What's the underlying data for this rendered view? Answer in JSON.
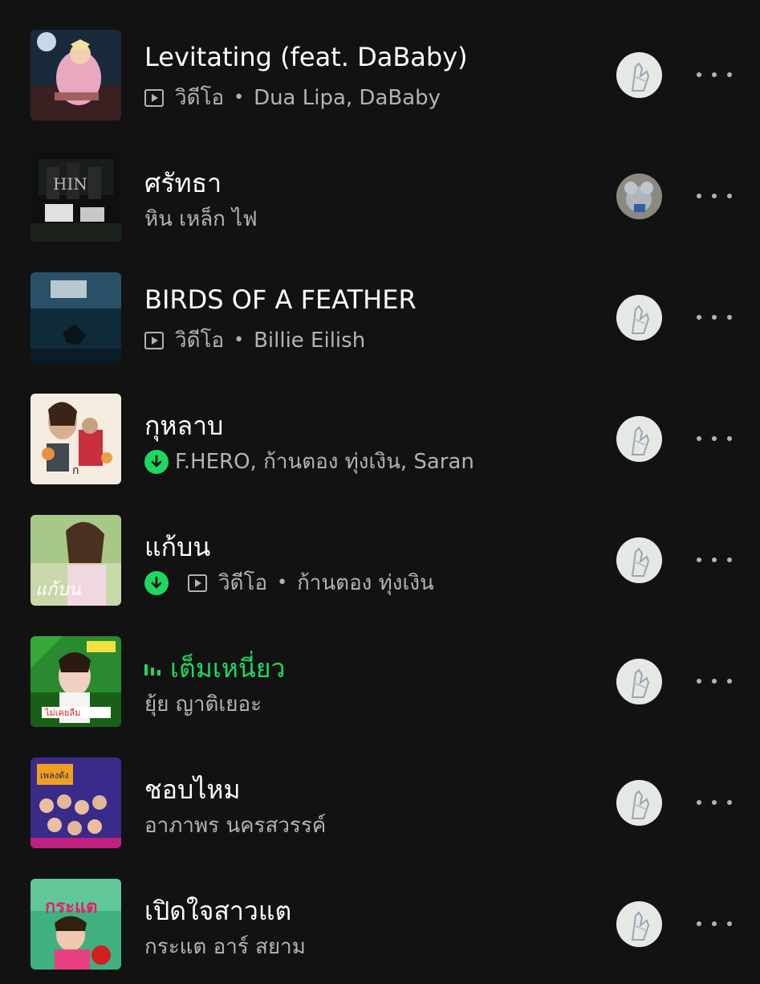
{
  "accent_color": "#1ed760",
  "tracks": [
    {
      "title": "Levitating (feat. DaBaby)",
      "video_label": "วิดีโอ",
      "artists": "Dua Lipa, DaBaby",
      "downloaded": false,
      "video": true,
      "playing": false,
      "added_by_avatar": "hands-avatar"
    },
    {
      "title": "ศรัทธา",
      "video_label": "",
      "artists": "หิน เหล็ก ไฟ",
      "downloaded": false,
      "video": false,
      "playing": false,
      "added_by_avatar": "mouse-avatar"
    },
    {
      "title": "BIRDS OF A FEATHER",
      "video_label": "วิดีโอ",
      "artists": "Billie Eilish",
      "downloaded": false,
      "video": true,
      "playing": false,
      "added_by_avatar": "hands-avatar"
    },
    {
      "title": "กุหลาบ",
      "video_label": "",
      "artists": "F.HERO, ก้านตอง ทุ่งเงิน, Saran",
      "downloaded": true,
      "video": false,
      "playing": false,
      "added_by_avatar": "hands-avatar"
    },
    {
      "title": "แก้บน",
      "video_label": "วิดีโอ",
      "artists": "ก้านตอง ทุ่งเงิน",
      "downloaded": true,
      "video": true,
      "playing": false,
      "added_by_avatar": "hands-avatar"
    },
    {
      "title": "เต็มเหนี่ยว",
      "video_label": "",
      "artists": "ยุ้ย ญาติเยอะ",
      "downloaded": false,
      "video": false,
      "playing": true,
      "added_by_avatar": "hands-avatar"
    },
    {
      "title": "ชอบไหม",
      "video_label": "",
      "artists": "อาภาพร นครสวรรค์",
      "downloaded": false,
      "video": false,
      "playing": false,
      "added_by_avatar": "hands-avatar"
    },
    {
      "title": "เปิดใจสาวแต",
      "video_label": "",
      "artists": "กระแต อาร์ สยาม",
      "downloaded": false,
      "video": false,
      "playing": false,
      "added_by_avatar": "hands-avatar"
    }
  ]
}
